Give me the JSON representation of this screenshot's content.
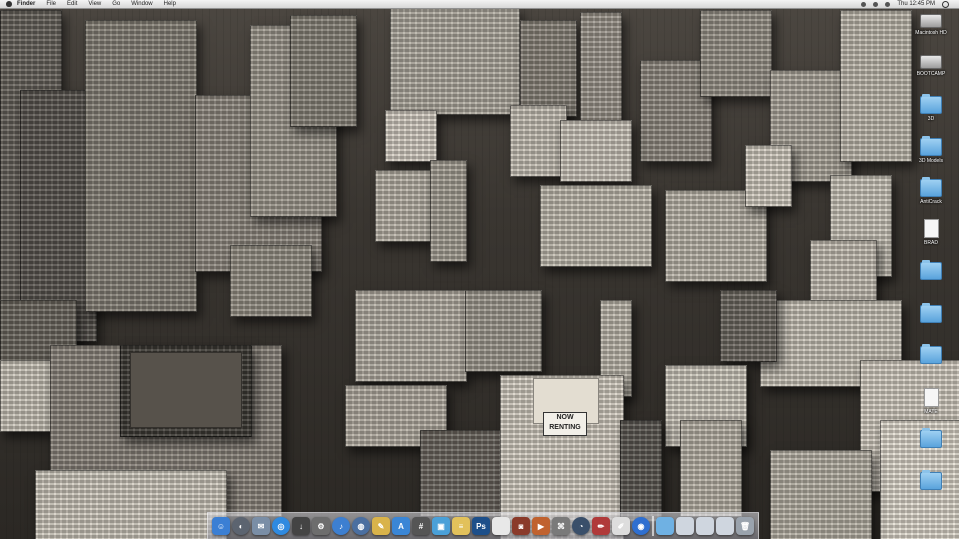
{
  "menubar": {
    "app_name": "Finder",
    "menus": [
      "File",
      "Edit",
      "View",
      "Go",
      "Window",
      "Help"
    ],
    "clock": "Thu 12:45 PM"
  },
  "wallpaper": {
    "billboard_line1": "NOW",
    "billboard_line2": "RENTING"
  },
  "desktop_icons": [
    {
      "label": "Macintosh HD",
      "type": "drive"
    },
    {
      "label": "BOOTCAMP",
      "type": "drive"
    },
    {
      "label": "3D",
      "type": "folder"
    },
    {
      "label": "3D Models",
      "type": "folder"
    },
    {
      "label": "AntiCrack",
      "type": "folder"
    },
    {
      "label": "BRAD",
      "type": "doc"
    },
    {
      "label": "",
      "type": "folder"
    },
    {
      "label": "",
      "type": "folder"
    },
    {
      "label": "",
      "type": "folder"
    },
    {
      "label": "MATE",
      "type": "doc"
    },
    {
      "label": "",
      "type": "folder"
    },
    {
      "label": "",
      "type": "folder"
    }
  ],
  "dock": {
    "items": [
      {
        "name": "finder",
        "color": "#3b7fd4",
        "glyph": "☺",
        "round": false
      },
      {
        "name": "dashboard",
        "color": "#5c6470",
        "glyph": "◐",
        "round": true
      },
      {
        "name": "mail",
        "color": "#7a8ea6",
        "glyph": "✉",
        "round": false
      },
      {
        "name": "safari",
        "color": "#2f8ae0",
        "glyph": "◎",
        "round": true
      },
      {
        "name": "downloads",
        "color": "#444444",
        "glyph": "↓",
        "round": false
      },
      {
        "name": "system-preferences",
        "color": "#6d6d6d",
        "glyph": "⚙",
        "round": false
      },
      {
        "name": "itunes",
        "color": "#3d7fd0",
        "glyph": "♪",
        "round": true
      },
      {
        "name": "network",
        "color": "#4b6fa0",
        "glyph": "◍",
        "round": true
      },
      {
        "name": "notes",
        "color": "#d9b34a",
        "glyph": "✎",
        "round": false
      },
      {
        "name": "app-store",
        "color": "#3a86d6",
        "glyph": "A",
        "round": false
      },
      {
        "name": "calculator",
        "color": "#555555",
        "glyph": "#",
        "round": false
      },
      {
        "name": "preview",
        "color": "#4aa0d8",
        "glyph": "▣",
        "round": false
      },
      {
        "name": "stickies",
        "color": "#e2c15b",
        "glyph": "≡",
        "round": false
      },
      {
        "name": "photoshop",
        "color": "#1d4f8a",
        "glyph": "Ps",
        "round": false
      },
      {
        "name": "document",
        "color": "#e8e8e8",
        "glyph": "",
        "round": false
      },
      {
        "name": "photo-booth",
        "color": "#8a3a2a",
        "glyph": "◙",
        "round": false
      },
      {
        "name": "slideshow",
        "color": "#c0622f",
        "glyph": "▶",
        "round": false
      },
      {
        "name": "utilities",
        "color": "#7a7a7a",
        "glyph": "⌘",
        "round": false
      },
      {
        "name": "time-machine",
        "color": "#3a4f6a",
        "glyph": "◔",
        "round": true
      },
      {
        "name": "pencil-tool",
        "color": "#b03a3a",
        "glyph": "✏",
        "round": false
      },
      {
        "name": "textedit",
        "color": "#dddddd",
        "glyph": "✐",
        "round": false
      },
      {
        "name": "web",
        "color": "#2f6fd0",
        "glyph": "◉",
        "round": true
      },
      {
        "name": "sep",
        "color": "",
        "glyph": "",
        "round": false
      },
      {
        "name": "applications-folder",
        "color": "#6fb1e3",
        "glyph": "",
        "round": false
      },
      {
        "name": "documents-stack",
        "color": "#cfd6df",
        "glyph": "",
        "round": false
      },
      {
        "name": "downloads-stack",
        "color": "#cfd6df",
        "glyph": "",
        "round": false
      },
      {
        "name": "stack",
        "color": "#cfd6df",
        "glyph": "",
        "round": false
      },
      {
        "name": "trash",
        "color": "#9aa3ad",
        "glyph": "🗑",
        "round": false
      }
    ]
  }
}
